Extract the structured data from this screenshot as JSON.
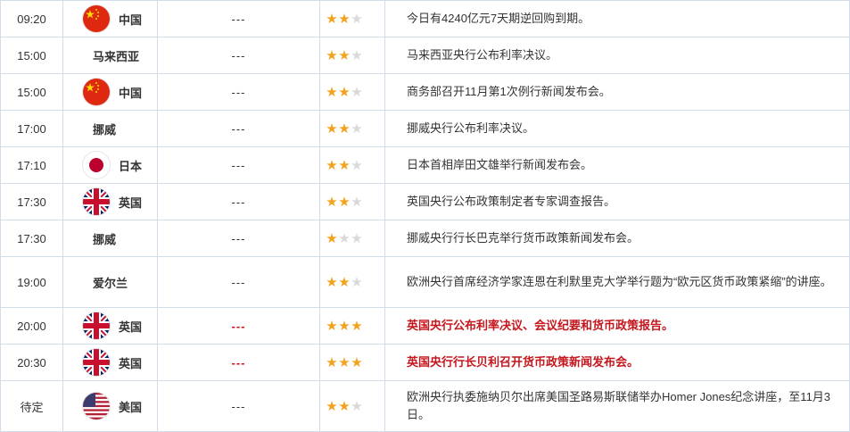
{
  "colors": {
    "star_on": "#f3a21b",
    "star_off": "#d9d9d9",
    "important_text": "#c4161c",
    "border": "#d3dcea"
  },
  "events": [
    {
      "time": "09:20",
      "country": "中国",
      "flag": "china-flag-icon",
      "value": "---",
      "stars": 2,
      "desc": "今日有4240亿元7天期逆回购到期。",
      "important": false,
      "tall": false
    },
    {
      "time": "15:00",
      "country": "马来西亚",
      "flag": "",
      "value": "---",
      "stars": 2,
      "desc": "马来西亚央行公布利率决议。",
      "important": false,
      "tall": false
    },
    {
      "time": "15:00",
      "country": "中国",
      "flag": "china-flag-icon",
      "value": "---",
      "stars": 2,
      "desc": "商务部召开11月第1次例行新闻发布会。",
      "important": false,
      "tall": false
    },
    {
      "time": "17:00",
      "country": "挪威",
      "flag": "",
      "value": "---",
      "stars": 2,
      "desc": "挪威央行公布利率决议。",
      "important": false,
      "tall": false
    },
    {
      "time": "17:10",
      "country": "日本",
      "flag": "japan-flag-icon",
      "value": "---",
      "stars": 2,
      "desc": "日本首相岸田文雄举行新闻发布会。",
      "important": false,
      "tall": false
    },
    {
      "time": "17:30",
      "country": "英国",
      "flag": "uk-flag-icon",
      "value": "---",
      "stars": 2,
      "desc": "英国央行公布政策制定者专家调查报告。",
      "important": false,
      "tall": false
    },
    {
      "time": "17:30",
      "country": "挪威",
      "flag": "",
      "value": "---",
      "stars": 1,
      "desc": "挪威央行行长巴克举行货币政策新闻发布会。",
      "important": false,
      "tall": false
    },
    {
      "time": "19:00",
      "country": "爱尔兰",
      "flag": "",
      "value": "---",
      "stars": 2,
      "desc": "欧洲央行首席经济学家连恩在利默里克大学举行题为“欧元区货币政策紧缩”的讲座。",
      "important": false,
      "tall": true
    },
    {
      "time": "20:00",
      "country": "英国",
      "flag": "uk-flag-icon",
      "value": "---",
      "stars": 3,
      "desc": "英国央行公布利率决议、会议纪要和货币政策报告。",
      "important": true,
      "tall": false
    },
    {
      "time": "20:30",
      "country": "英国",
      "flag": "uk-flag-icon",
      "value": "---",
      "stars": 3,
      "desc": "英国央行行长贝利召开货币政策新闻发布会。",
      "important": true,
      "tall": false
    },
    {
      "time": "待定",
      "country": "美国",
      "flag": "usa-flag-icon",
      "value": "---",
      "stars": 2,
      "desc": "欧洲央行执委施纳贝尔出席美国圣路易斯联储举办Homer Jones纪念讲座，至11月3日。",
      "important": false,
      "tall": true
    }
  ]
}
